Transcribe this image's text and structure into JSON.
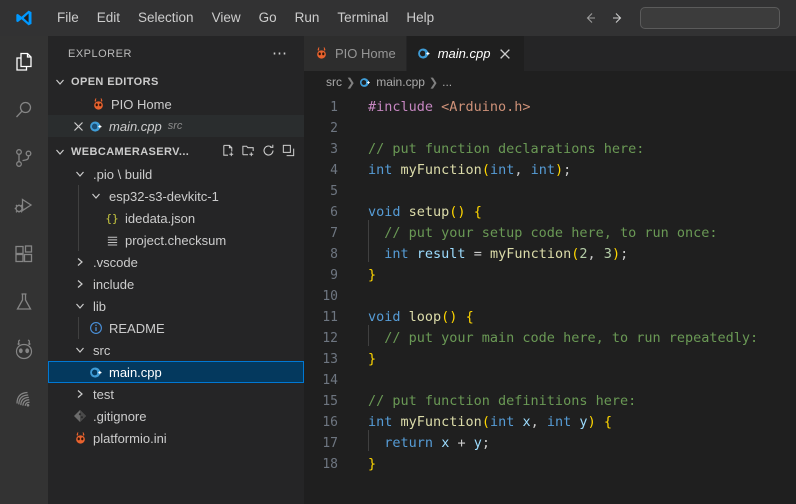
{
  "titlebar": {
    "logo_icon": "vscode-logo-icon",
    "menus": [
      "File",
      "Edit",
      "Selection",
      "View",
      "Go",
      "Run",
      "Terminal",
      "Help"
    ],
    "back_icon": "arrow-left-icon",
    "forward_icon": "arrow-right-icon",
    "search_value": "",
    "search_placeholder": ""
  },
  "activitybar": {
    "items": [
      {
        "name": "explorer",
        "icon": "files-icon",
        "active": true
      },
      {
        "name": "search",
        "icon": "search-icon",
        "active": false
      },
      {
        "name": "source-control",
        "icon": "source-control-icon",
        "active": false
      },
      {
        "name": "run-and-debug",
        "icon": "run-debug-icon",
        "active": false
      },
      {
        "name": "extensions",
        "icon": "extensions-icon",
        "active": false
      },
      {
        "name": "testing",
        "icon": "beaker-icon",
        "active": false
      },
      {
        "name": "platformio",
        "icon": "platformio-alien-icon",
        "active": false
      },
      {
        "name": "espressif",
        "icon": "espressif-icon",
        "active": false
      }
    ]
  },
  "sidebar": {
    "title": "EXPLORER",
    "more_actions_icon": "ellipsis-icon",
    "open_editors": {
      "label": "OPEN EDITORS",
      "expanded": true,
      "items": [
        {
          "name": "PIO Home",
          "icon": "platformio-alien-icon",
          "description": "",
          "selected": false,
          "dirty": false
        },
        {
          "name": "main.cpp",
          "icon": "cpp-icon",
          "description": "src",
          "selected": true,
          "dirty": false,
          "close_icon": "close-icon"
        }
      ]
    },
    "project": {
      "label": "WEBCAMERASERV...",
      "expanded": true,
      "actions": [
        {
          "name": "new-file",
          "icon": "new-file-icon"
        },
        {
          "name": "new-folder",
          "icon": "new-folder-icon"
        },
        {
          "name": "refresh",
          "icon": "refresh-icon"
        },
        {
          "name": "collapse-all",
          "icon": "collapse-all-icon"
        }
      ],
      "tree": [
        {
          "label": ".pio \\ build",
          "type": "folder",
          "depth": 1,
          "expanded": true,
          "icon": "chevron-down-icon"
        },
        {
          "label": "esp32-s3-devkitc-1",
          "type": "folder",
          "depth": 2,
          "expanded": true,
          "icon": "chevron-down-icon"
        },
        {
          "label": "idedata.json",
          "type": "file",
          "depth": 3,
          "icon": "json-icon"
        },
        {
          "label": "project.checksum",
          "type": "file",
          "depth": 3,
          "icon": "text-file-icon"
        },
        {
          "label": ".vscode",
          "type": "folder",
          "depth": 1,
          "expanded": false,
          "icon": "chevron-right-icon"
        },
        {
          "label": "include",
          "type": "folder",
          "depth": 1,
          "expanded": false,
          "icon": "chevron-right-icon"
        },
        {
          "label": "lib",
          "type": "folder",
          "depth": 1,
          "expanded": true,
          "icon": "chevron-down-icon"
        },
        {
          "label": "README",
          "type": "file",
          "depth": 2,
          "icon": "info-icon"
        },
        {
          "label": "src",
          "type": "folder",
          "depth": 1,
          "expanded": true,
          "icon": "chevron-down-icon"
        },
        {
          "label": "main.cpp",
          "type": "file",
          "depth": 2,
          "icon": "cpp-icon",
          "selected": true
        },
        {
          "label": "test",
          "type": "folder",
          "depth": 1,
          "expanded": false,
          "icon": "chevron-right-icon"
        },
        {
          "label": ".gitignore",
          "type": "file",
          "depth": 1,
          "icon": "git-icon"
        },
        {
          "label": "platformio.ini",
          "type": "file",
          "depth": 1,
          "icon": "platformio-alien-icon"
        }
      ]
    }
  },
  "editor": {
    "tabs": [
      {
        "label": "PIO Home",
        "icon": "platformio-alien-icon",
        "active": false
      },
      {
        "label": "main.cpp",
        "icon": "cpp-icon",
        "active": true,
        "close_icon": "close-icon"
      }
    ],
    "breadcrumb": [
      "src",
      "main.cpp",
      "..."
    ],
    "language": "cpp",
    "lines": [
      {
        "n": "1",
        "tokens": [
          {
            "t": "#include ",
            "c": "t-pre"
          },
          {
            "t": "<Arduino.h>",
            "c": "t-str"
          }
        ]
      },
      {
        "n": "2",
        "tokens": []
      },
      {
        "n": "3",
        "tokens": [
          {
            "t": "// put function declarations here:",
            "c": "t-cmt"
          }
        ]
      },
      {
        "n": "4",
        "tokens": [
          {
            "t": "int",
            "c": "t-kw"
          },
          {
            "t": " ",
            "c": "t-op"
          },
          {
            "t": "myFunction",
            "c": "t-fn"
          },
          {
            "t": "(",
            "c": "t-br1"
          },
          {
            "t": "int",
            "c": "t-kw"
          },
          {
            "t": ", ",
            "c": "t-op"
          },
          {
            "t": "int",
            "c": "t-kw"
          },
          {
            "t": ")",
            "c": "t-br1"
          },
          {
            "t": ";",
            "c": "t-op"
          }
        ]
      },
      {
        "n": "5",
        "tokens": []
      },
      {
        "n": "6",
        "tokens": [
          {
            "t": "void",
            "c": "t-kw"
          },
          {
            "t": " ",
            "c": "t-op"
          },
          {
            "t": "setup",
            "c": "t-fn"
          },
          {
            "t": "()",
            "c": "t-br1"
          },
          {
            "t": " ",
            "c": "t-op"
          },
          {
            "t": "{",
            "c": "t-br1"
          }
        ]
      },
      {
        "n": "7",
        "indent": true,
        "tokens": [
          {
            "t": "  // put your setup code here, to run once:",
            "c": "t-cmt"
          }
        ]
      },
      {
        "n": "8",
        "indent": true,
        "tokens": [
          {
            "t": "  ",
            "c": "t-op"
          },
          {
            "t": "int",
            "c": "t-kw"
          },
          {
            "t": " ",
            "c": "t-op"
          },
          {
            "t": "result",
            "c": "t-var"
          },
          {
            "t": " = ",
            "c": "t-op"
          },
          {
            "t": "myFunction",
            "c": "t-fn"
          },
          {
            "t": "(",
            "c": "t-br1"
          },
          {
            "t": "2",
            "c": "t-num"
          },
          {
            "t": ", ",
            "c": "t-op"
          },
          {
            "t": "3",
            "c": "t-num"
          },
          {
            "t": ")",
            "c": "t-br1"
          },
          {
            "t": ";",
            "c": "t-op"
          }
        ]
      },
      {
        "n": "9",
        "tokens": [
          {
            "t": "}",
            "c": "t-br1"
          }
        ]
      },
      {
        "n": "10",
        "tokens": []
      },
      {
        "n": "11",
        "tokens": [
          {
            "t": "void",
            "c": "t-kw"
          },
          {
            "t": " ",
            "c": "t-op"
          },
          {
            "t": "loop",
            "c": "t-fn"
          },
          {
            "t": "()",
            "c": "t-br1"
          },
          {
            "t": " ",
            "c": "t-op"
          },
          {
            "t": "{",
            "c": "t-br1"
          }
        ]
      },
      {
        "n": "12",
        "indent": true,
        "tokens": [
          {
            "t": "  // put your main code here, to run repeatedly:",
            "c": "t-cmt"
          }
        ]
      },
      {
        "n": "13",
        "tokens": [
          {
            "t": "}",
            "c": "t-br1"
          }
        ]
      },
      {
        "n": "14",
        "tokens": []
      },
      {
        "n": "15",
        "tokens": [
          {
            "t": "// put function definitions here:",
            "c": "t-cmt"
          }
        ]
      },
      {
        "n": "16",
        "tokens": [
          {
            "t": "int",
            "c": "t-kw"
          },
          {
            "t": " ",
            "c": "t-op"
          },
          {
            "t": "myFunction",
            "c": "t-fn"
          },
          {
            "t": "(",
            "c": "t-br1"
          },
          {
            "t": "int",
            "c": "t-kw"
          },
          {
            "t": " ",
            "c": "t-op"
          },
          {
            "t": "x",
            "c": "t-var"
          },
          {
            "t": ", ",
            "c": "t-op"
          },
          {
            "t": "int",
            "c": "t-kw"
          },
          {
            "t": " ",
            "c": "t-op"
          },
          {
            "t": "y",
            "c": "t-var"
          },
          {
            "t": ")",
            "c": "t-br1"
          },
          {
            "t": " ",
            "c": "t-op"
          },
          {
            "t": "{",
            "c": "t-br1"
          }
        ]
      },
      {
        "n": "17",
        "indent": true,
        "tokens": [
          {
            "t": "  ",
            "c": "t-op"
          },
          {
            "t": "return",
            "c": "t-kw"
          },
          {
            "t": " ",
            "c": "t-op"
          },
          {
            "t": "x",
            "c": "t-var"
          },
          {
            "t": " + ",
            "c": "t-op"
          },
          {
            "t": "y",
            "c": "t-var"
          },
          {
            "t": ";",
            "c": "t-op"
          }
        ]
      },
      {
        "n": "18",
        "tokens": [
          {
            "t": "}",
            "c": "t-br1"
          }
        ]
      }
    ]
  },
  "colors": {
    "accent": "#0078d4",
    "selection_bg": "#04395e",
    "titlebar_bg": "#323233",
    "activitybar_bg": "#333333",
    "sidebar_bg": "#252526",
    "editor_bg": "#1f1f1f",
    "tab_inactive_bg": "#2d2d2d",
    "platformio_orange": "#e8622e",
    "cpp_blue": "#3f9cd6"
  }
}
